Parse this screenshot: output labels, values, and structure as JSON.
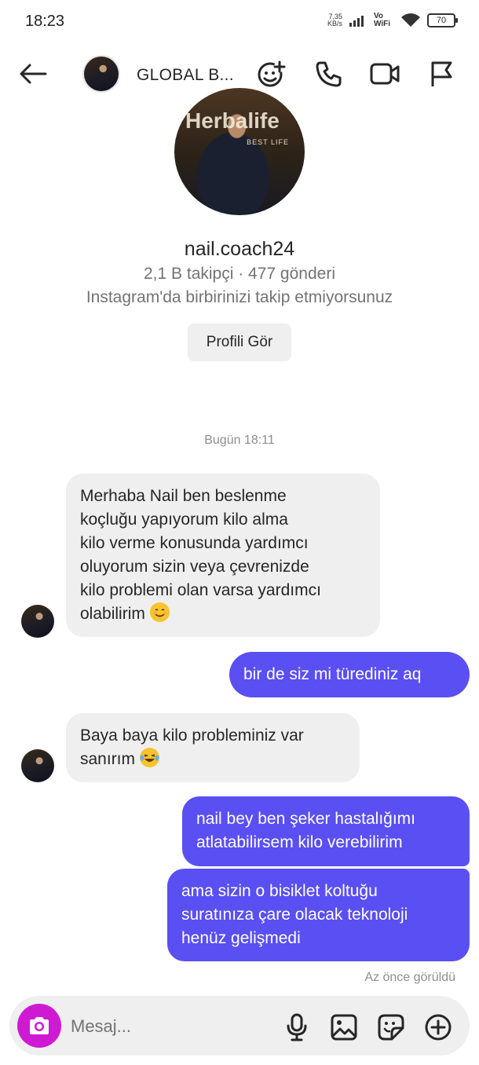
{
  "status_bar": {
    "time": "18:23",
    "net_speed_value": "7,35",
    "net_speed_unit": "KB/s",
    "vo_wifi": "Vo WiFi",
    "battery": "70"
  },
  "header": {
    "title": "GLOBAL B...",
    "icons": [
      "back-arrow-icon",
      "avatar",
      "add-people-icon",
      "phone-icon",
      "video-icon",
      "flag-icon"
    ]
  },
  "profile": {
    "username": "nail.coach24",
    "stats": "2,1 B takipçi · 477 gönderi",
    "follow_note": "Instagram'da birbirinizi takip etmiyorsunuz",
    "view_profile_label": "Profili Gör"
  },
  "conversation": {
    "timestamp": "Bugün 18:11",
    "messages": [
      {
        "from": "other",
        "lines": [
          "Merhaba Nail ben beslenme",
          "koçluğu yapıyorum kilo alma",
          "kilo verme konusunda yardımcı",
          "oluyorum sizin veya çevrenizde",
          "kilo problemi olan varsa yardımcı",
          "olabilirim"
        ],
        "emoji": "smiling-face-emoji"
      },
      {
        "from": "me",
        "lines": [
          "bir de siz mi türediniz aq"
        ]
      },
      {
        "from": "other",
        "lines": [
          "Baya baya kilo probleminiz var",
          "sanırım"
        ],
        "emoji": "tears-of-joy-emoji"
      },
      {
        "from": "me",
        "lines": [
          "nail bey ben şeker hastalığımı",
          "atlatabilirsem kilo verebilirim"
        ]
      },
      {
        "from": "me",
        "lines": [
          "ama sizin o bisiklet koltuğu",
          "suratınıza çare olacak teknoloji",
          "henüz gelişmedi"
        ]
      }
    ],
    "seen_label": "Az önce görüldü"
  },
  "composer": {
    "placeholder": "Mesaj...",
    "icons": [
      "camera-icon",
      "microphone-icon",
      "gallery-icon",
      "sticker-icon",
      "plus-icon"
    ]
  },
  "colors": {
    "sent_bubble": "#5a4ff2",
    "received_bubble": "#efefef",
    "camera_button": "#cf1ad4",
    "secondary_text": "#737373"
  }
}
